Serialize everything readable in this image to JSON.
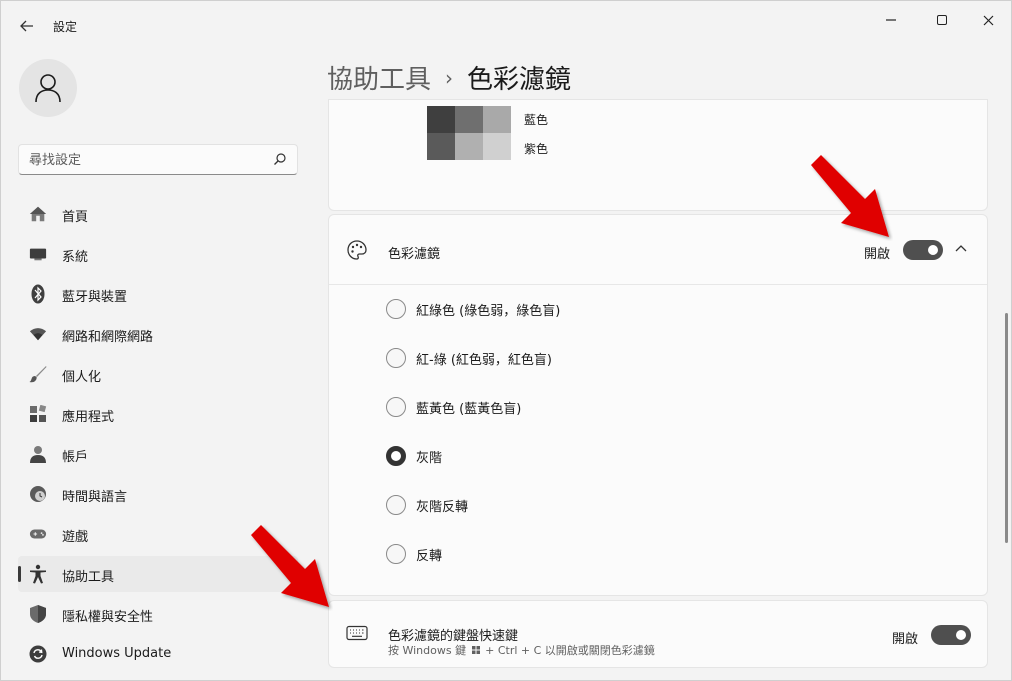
{
  "window": {
    "app_title": "設定"
  },
  "search": {
    "placeholder": "尋找設定"
  },
  "nav": {
    "items": [
      {
        "label": "首頁",
        "icon": "home-icon"
      },
      {
        "label": "系統",
        "icon": "system-icon"
      },
      {
        "label": "藍牙與裝置",
        "icon": "bluetooth-icon"
      },
      {
        "label": "網路和網際網路",
        "icon": "wifi-icon"
      },
      {
        "label": "個人化",
        "icon": "brush-icon"
      },
      {
        "label": "應用程式",
        "icon": "apps-icon"
      },
      {
        "label": "帳戶",
        "icon": "account-icon"
      },
      {
        "label": "時間與語言",
        "icon": "time-language-icon"
      },
      {
        "label": "遊戲",
        "icon": "gamepad-icon"
      },
      {
        "label": "協助工具",
        "icon": "accessibility-icon"
      },
      {
        "label": "隱私權與安全性",
        "icon": "shield-icon"
      },
      {
        "label": "Windows Update",
        "icon": "update-icon"
      }
    ],
    "active_index": 9
  },
  "breadcrumb": {
    "parent": "協助工具",
    "separator": "›",
    "current": "色彩濾鏡"
  },
  "preview": {
    "labels": [
      "藍色",
      "紫色"
    ],
    "swatch_colors": [
      "#3f3f3f",
      "#6f6f6f",
      "#a9a9a9",
      "#5a5a5a",
      "#b0b0b0",
      "#d0d0d0"
    ]
  },
  "color_filter": {
    "title": "色彩濾鏡",
    "toggle_label": "開啟",
    "toggle_on": true,
    "options": [
      {
        "label": "紅綠色 (綠色弱，綠色盲)",
        "selected": false
      },
      {
        "label": "紅-綠 (紅色弱，紅色盲)",
        "selected": false
      },
      {
        "label": "藍黃色 (藍黃色盲)",
        "selected": false
      },
      {
        "label": "灰階",
        "selected": true
      },
      {
        "label": "灰階反轉",
        "selected": false
      },
      {
        "label": "反轉",
        "selected": false
      }
    ]
  },
  "shortcut": {
    "title": "色彩濾鏡的鍵盤快速鍵",
    "sub_before": "按 Windows 鍵",
    "sub_after": "+ Ctrl + C 以開啟或關閉色彩濾鏡",
    "toggle_label": "開啟",
    "toggle_on": true
  },
  "colors": {
    "accent": "#4f4f4f",
    "annotation_arrow": "#e00000"
  }
}
